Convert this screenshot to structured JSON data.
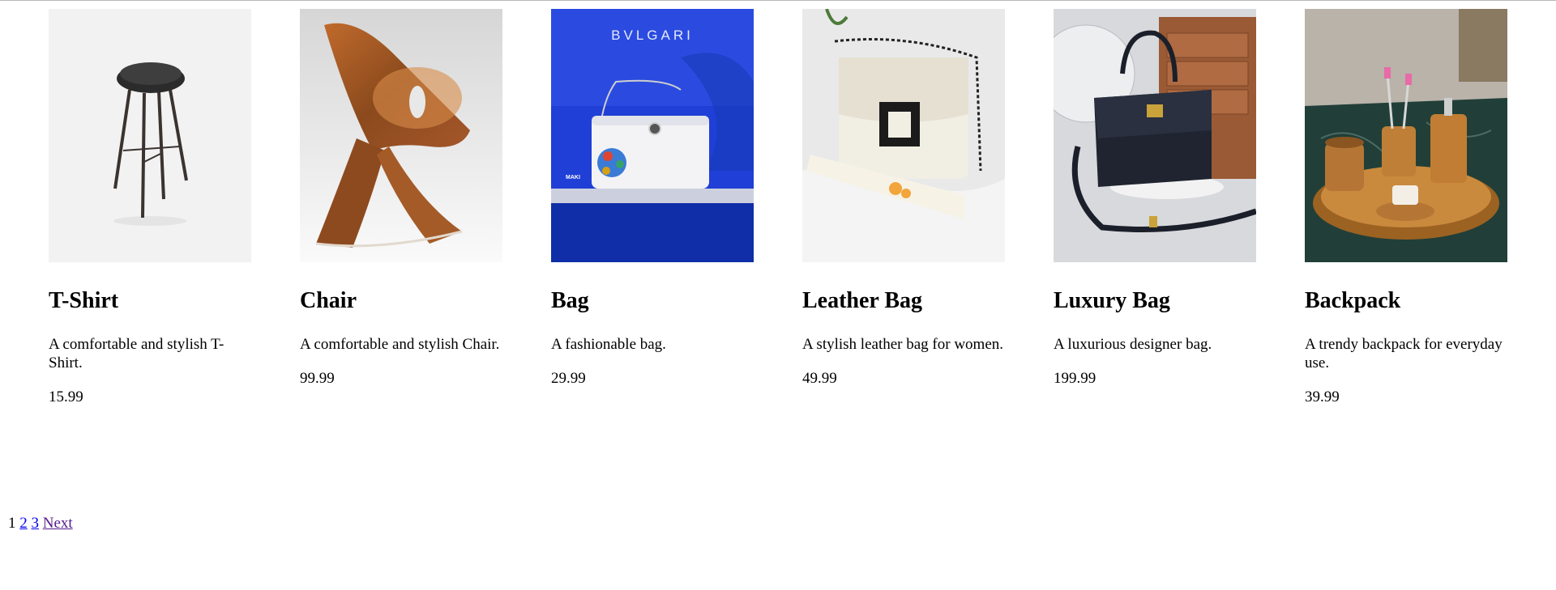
{
  "products": [
    {
      "title": "T-Shirt",
      "description": "A comfortable and stylish T-Shirt.",
      "price": "15.99",
      "image_icon": "bar-stool-icon"
    },
    {
      "title": "Chair",
      "description": "A comfortable and stylish Chair.",
      "price": "99.99",
      "image_icon": "wooden-chair-icon"
    },
    {
      "title": "Bag",
      "description": "A fashionable bag.",
      "price": "29.99",
      "image_icon": "white-handbag-icon",
      "image_brand_text": "BVLGARI",
      "image_small_text": "MAKI"
    },
    {
      "title": "Leather Bag",
      "description": "A stylish leather bag for women.",
      "price": "49.99",
      "image_icon": "quilted-bag-icon"
    },
    {
      "title": "Luxury Bag",
      "description": "A luxurious designer bag.",
      "price": "199.99",
      "image_icon": "black-handbag-icon"
    },
    {
      "title": "Backpack",
      "description": "A trendy backpack for everyday use.",
      "price": "39.99",
      "image_icon": "bathroom-set-icon"
    }
  ],
  "pagination": {
    "current": "1",
    "pages": [
      "2",
      "3"
    ],
    "next_label": "Next"
  }
}
